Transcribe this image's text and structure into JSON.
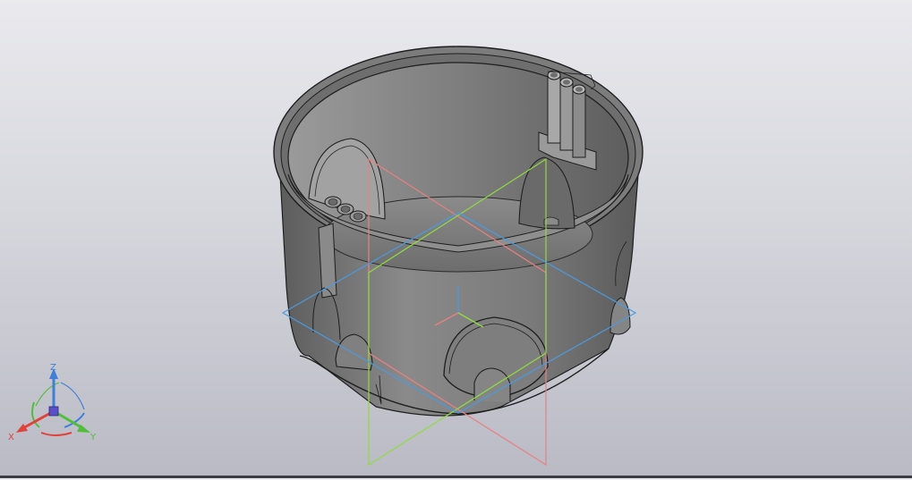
{
  "triad": {
    "x_label": "X",
    "y_label": "Y",
    "z_label": "Z",
    "x_color": "#e0413a",
    "y_color": "#4fbf3a",
    "z_color": "#3f7fd9"
  },
  "scene": {
    "model": "round-junction-box",
    "model_color": "#7a7a7a",
    "plane_colors": {
      "front": "#e98080",
      "right": "#8fdc3e",
      "top": "#4a9be0"
    },
    "background": [
      "#e9e9ee",
      "#b9bac4"
    ]
  }
}
